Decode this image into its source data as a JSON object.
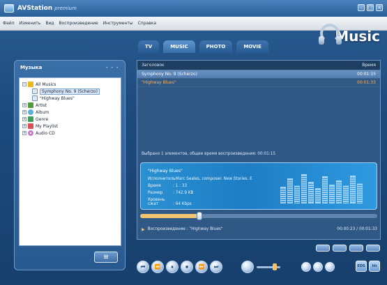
{
  "app": {
    "title": "AVStation",
    "title_suffix": "premium",
    "window_buttons": [
      "minimize",
      "maximize",
      "close"
    ]
  },
  "menu": {
    "items": [
      "Файл",
      "Изменить",
      "Вид",
      "Воспроизведение",
      "Инструменты",
      "Справка"
    ]
  },
  "banner": {
    "title": "Music",
    "icon": "headphones-icon"
  },
  "tabs": [
    {
      "label": "TV"
    },
    {
      "label": "MUSIC"
    },
    {
      "label": "PHOTO"
    },
    {
      "label": "MOVIE"
    }
  ],
  "sidebar": {
    "title": "Музыка",
    "tree": [
      {
        "label": "All Musics",
        "icon": "music-note-icon",
        "expanded": true,
        "children": [
          {
            "label": "Symphony No. 9 (Scherzo)",
            "selected": true
          },
          {
            "label": "\"Highway Blues\""
          }
        ]
      },
      {
        "label": "Artist",
        "icon": "artist-icon"
      },
      {
        "label": "Album",
        "icon": "album-icon"
      },
      {
        "label": "Genre",
        "icon": "genre-icon"
      },
      {
        "label": "My Playlist",
        "icon": "playlist-icon"
      },
      {
        "label": "Audio CD",
        "icon": "cd-icon"
      }
    ],
    "add_button": "playlist-add-icon"
  },
  "tracklist": {
    "headers": {
      "title": "Заголовок",
      "time": "Время"
    },
    "rows": [
      {
        "title": "Symphony No. 9 (Scherzo)",
        "time": "00:01:15",
        "state": "selected"
      },
      {
        "title": "\"Highway Blues\"",
        "time": "00:01:33",
        "state": "playing"
      }
    ],
    "summary": "Выбрано 1 элементов, общее время воспроизведения: 00:01:15"
  },
  "nowplaying": {
    "title": "\"Highway Blues\"",
    "rows": [
      {
        "label": "Исполнитель",
        "value": ": Marc Seales, composer. New Stories. E"
      },
      {
        "label": "Время",
        "value": ": 1 : 33"
      },
      {
        "label": "Размер",
        "value": ": 742.9 KB"
      },
      {
        "label": "Уровень сжат",
        "value": ": 64 Kbps"
      }
    ],
    "eq_levels": [
      0.55,
      0.82,
      0.6,
      0.95,
      0.7,
      0.5,
      0.88,
      0.62,
      0.76,
      0.58,
      0.9,
      0.66
    ]
  },
  "playback": {
    "progress": 0.25,
    "status": "Воспроизведение : \"Highway Blues\"",
    "time": "00:00:23 / 00:01:33"
  },
  "controls": {
    "transport": [
      {
        "name": "previous-button",
        "glyph": "⏮"
      },
      {
        "name": "rewind-button",
        "glyph": "⏪"
      },
      {
        "name": "pause-button",
        "glyph": "⏸"
      },
      {
        "name": "stop-button",
        "glyph": "⏹"
      },
      {
        "name": "forward-button",
        "glyph": "⏩"
      },
      {
        "name": "next-button",
        "glyph": "⏭"
      }
    ],
    "volume_level": 0.75,
    "side_buttons": [
      "repeat-icon",
      "shuffle-icon",
      "settings-icon"
    ],
    "right_labels": [
      "EDS",
      "lılı"
    ]
  },
  "colors": {
    "accent": "#2b90d1",
    "playing": "#f4b36a",
    "progress": "#f2c46d"
  }
}
